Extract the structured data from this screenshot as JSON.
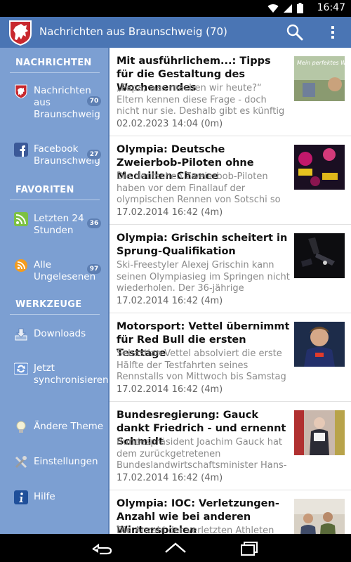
{
  "status_bar": {
    "time": "16:47",
    "icons": [
      "wifi-icon",
      "signal-icon",
      "battery-icon"
    ]
  },
  "action_bar": {
    "title": "Nachrichten aus Braunschweig (70)",
    "icons": [
      "braunschweig-lion-logo",
      "search-icon",
      "overflow-menu-icon"
    ],
    "color": "#4a75b4"
  },
  "drawer": {
    "color": "#7c9fd2",
    "sections": [
      {
        "heading": "NACHRICHTEN",
        "items": [
          {
            "label": "Nachrichten aus Braunschweig",
            "badge": "70",
            "icon": "braunschweig-lion-icon"
          },
          {
            "label": "Facebook Braunschweig",
            "badge": "27",
            "icon": "facebook-icon"
          }
        ]
      },
      {
        "heading": "FAVORITEN",
        "items": [
          {
            "label": "Letzten 24 Stunden",
            "badge": "36",
            "icon": "rss-icon"
          },
          {
            "label": "Alle Ungelesenen",
            "badge": "97",
            "icon": "rss-orange-icon"
          }
        ]
      },
      {
        "heading": "WERKZEUGE",
        "items": [
          {
            "label": "Downloads",
            "icon": "download-icon"
          },
          {
            "label": "Jetzt synchronisieren",
            "icon": "sync-icon"
          },
          {
            "label": "Ändere Theme",
            "icon": "lightbulb-icon"
          },
          {
            "label": "Einstellungen",
            "icon": "settings-tools-icon"
          },
          {
            "label": "Hilfe",
            "icon": "info-icon"
          }
        ]
      }
    ]
  },
  "articles": [
    {
      "title": "Mit ausführlichem...: Tipps für die Gestaltung des Wochenendes",
      "teaser": "„Papa, was machen wir heute?“ Eltern kennen diese Frage - doch nicht nur sie. Deshalb gibt es künftig Tipps für",
      "date": "02.02.2023 14:04 (0m)",
      "thumb_caption": "Mein perfektes Wochenende"
    },
    {
      "title": "Olympia: Deutsche Zweierbob-Piloten ohne Medaillen-Chance",
      "teaser": "Die deutschen Zweierbob-Piloten haben vor dem Finallauf der olympischen Rennen von Sotschi so",
      "date": "17.02.2014 16:42 (4m)"
    },
    {
      "title": "Olympia: Grischin scheitert in Sprung-Qualifikation",
      "teaser": "Ski-Freestyler Alexej Grischin kann seinen Olympiasieg im Springen nicht wiederholen. Der 36-jährige Weißrusse",
      "date": "17.02.2014 16:42 (4m)"
    },
    {
      "title": "Motorsport: Vettel übernimmt für Red Bull die ersten Testtage",
      "teaser": "Sebastian Vettel absolviert die erste Hälfte der Testfahrten seines Rennstalls von Mittwoch bis Samstag",
      "date": "17.02.2014 16:42 (4m)"
    },
    {
      "title": "Bundesregierung: Gauck dankt Friedrich - und ernennt Schmidt",
      "teaser": "Bundespräsident Joachim Gauck hat dem zurückgetretenen Bundeslandwirtschaftsminister Hans-",
      "date": "17.02.2014 16:42 (4m)"
    },
    {
      "title": "Olympia: IOC: Verletzungen-Anzahl wie bei anderen Winterspielen",
      "teaser": "Die Anzahl der verletzten Athleten bei",
      "date": ""
    }
  ],
  "nav_bar": {
    "icons": [
      "back-icon",
      "home-icon",
      "recent-apps-icon"
    ]
  }
}
